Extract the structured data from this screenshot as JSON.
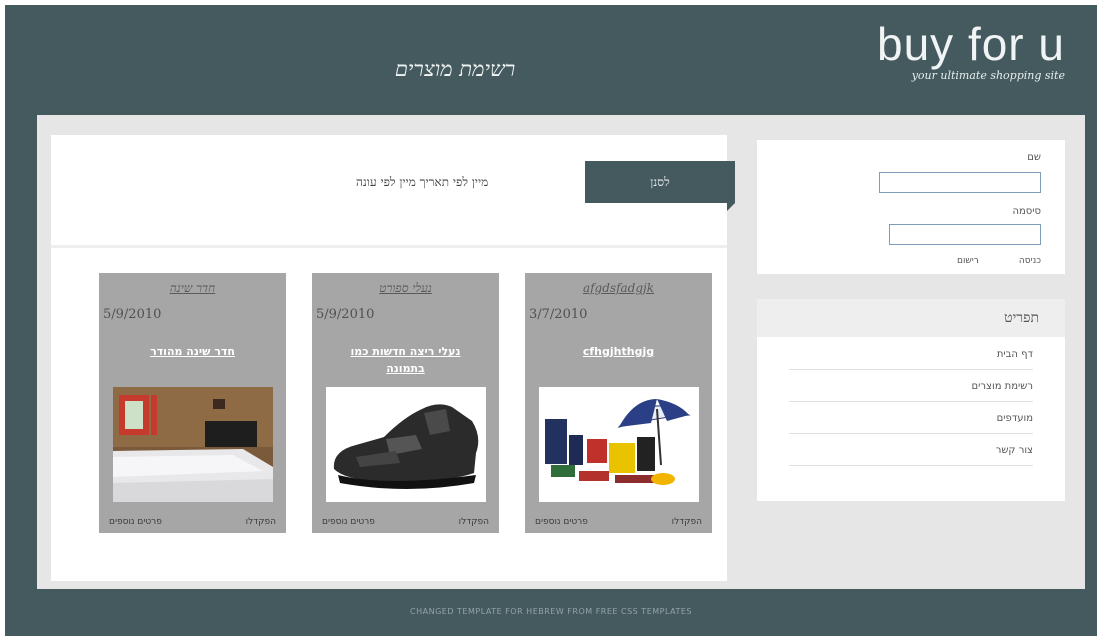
{
  "header": {
    "logo_text": "buy for u",
    "logo_tagline": "your ultimate shopping site",
    "page_title": "רשימת מוצרים"
  },
  "filter": {
    "text": "מיין לפי תאריך  מיין לפי עונה",
    "button_label": "לסנן"
  },
  "products": [
    {
      "title": "afgdsfadgjk",
      "date": "3/7/2010",
      "description": "cfhgjhthgjg",
      "image": "promotional-items-image",
      "links": {
        "right": "הפקדלו",
        "left": "פרטים נוספים"
      }
    },
    {
      "title": "נעלי ספורט",
      "date": "5/9/2010",
      "description": "נעלי ריצה חדשות כמו בתמונה",
      "image": "sneaker-image",
      "links": {
        "right": "הפקדלו",
        "left": "פרטים נוספים"
      }
    },
    {
      "title": "חדר שינה",
      "date": "5/9/2010",
      "description": "חדר שינה מהודר",
      "image": "bedroom-image",
      "links": {
        "right": "הפקדלו",
        "left": "פרטים נוספים"
      }
    }
  ],
  "login": {
    "username_label": "שם",
    "password_label": "סיסמה",
    "login_link": "כניסה",
    "register_link": "רישום"
  },
  "nav": {
    "header": "תפריט",
    "items": [
      "דף הבית",
      "רשימת מוצרים",
      "מועדפים",
      "צור קשר"
    ]
  },
  "footer": {
    "text": "CHANGED TEMPLATE FOR HEBREW FROM FREE CSS TEMPLATES"
  },
  "colors": {
    "frame": "#455a5f",
    "content_bg": "#e6e6e6",
    "card_bg": "#a6a6a6"
  }
}
